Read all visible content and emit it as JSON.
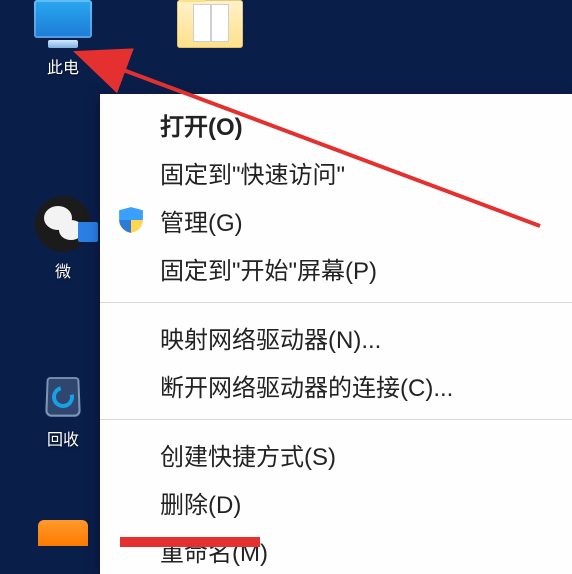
{
  "desktop": {
    "icons": {
      "this_pc_label": "此电",
      "folder_partial_label": "",
      "wechat_label": "微",
      "recycle_bin_label": "回收"
    }
  },
  "context_menu": {
    "items": [
      {
        "label": "打开(O)",
        "bold": true,
        "icon": null
      },
      {
        "label": "固定到\"快速访问\"",
        "bold": false,
        "icon": null
      },
      {
        "label": "管理(G)",
        "bold": false,
        "icon": "shield"
      },
      {
        "label": "固定到\"开始\"屏幕(P)",
        "bold": false,
        "icon": null
      },
      {
        "sep": true
      },
      {
        "label": "映射网络驱动器(N)...",
        "bold": false,
        "icon": null
      },
      {
        "label": "断开网络驱动器的连接(C)...",
        "bold": false,
        "icon": null
      },
      {
        "sep": true
      },
      {
        "label": "创建快捷方式(S)",
        "bold": false,
        "icon": null
      },
      {
        "label": "删除(D)",
        "bold": false,
        "icon": null
      },
      {
        "label": "重命名(M)",
        "bold": false,
        "icon": null
      }
    ]
  },
  "annotation": {
    "arrow_color": "#e53030"
  }
}
